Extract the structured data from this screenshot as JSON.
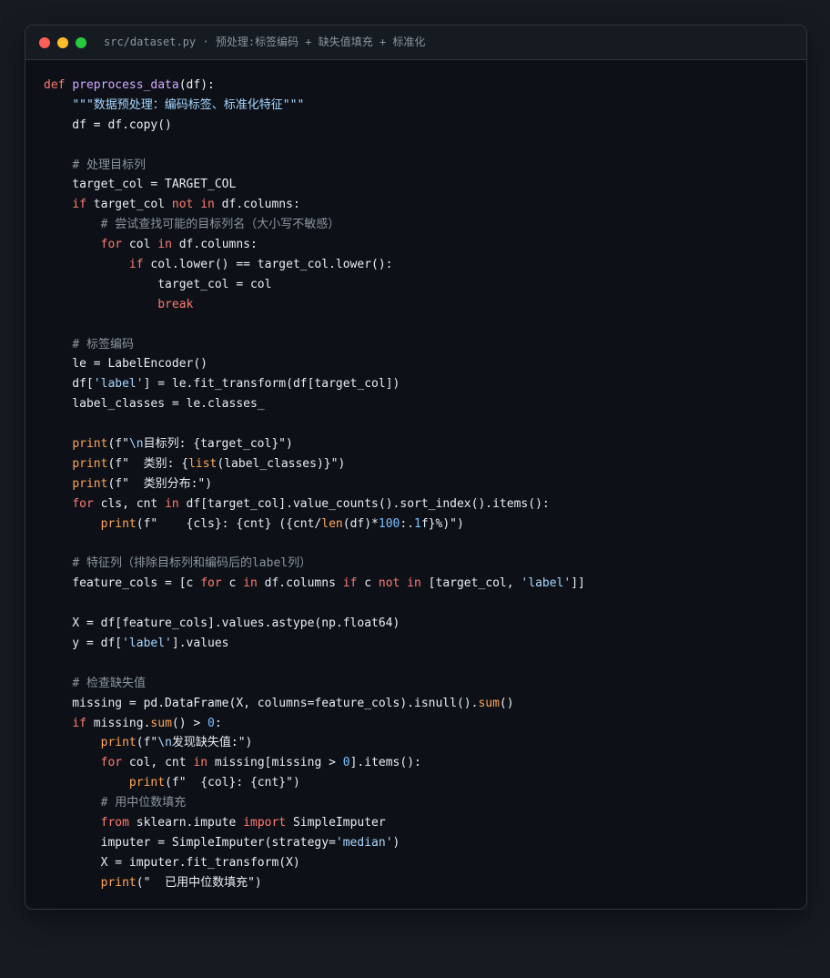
{
  "window": {
    "title": "src/dataset.py · 预处理:标签编码 + 缺失值填充 + 标准化"
  },
  "colors": {
    "keyword": "#ff7b72",
    "function": "#d2a8ff",
    "string": "#a5d6ff",
    "comment": "#8b949e",
    "builtin": "#ffa657",
    "number": "#79c0ff",
    "text": "#e6edf3",
    "background": "#0d1117"
  },
  "code": {
    "lines": [
      [
        [
          "kw",
          "def"
        ],
        [
          "txt",
          " "
        ],
        [
          "fn",
          "preprocess_data"
        ],
        [
          "txt",
          "(df):"
        ]
      ],
      [
        [
          "txt",
          "    "
        ],
        [
          "str",
          "\"\"\"数据预处理：编码标签、标准化特征\"\"\""
        ]
      ],
      [
        [
          "txt",
          "    df = df.copy()"
        ]
      ],
      [],
      [
        [
          "txt",
          "    "
        ],
        [
          "com",
          "# 处理目标列"
        ]
      ],
      [
        [
          "txt",
          "    target_col = TARGET_COL"
        ]
      ],
      [
        [
          "txt",
          "    "
        ],
        [
          "kw",
          "if"
        ],
        [
          "txt",
          " target_col "
        ],
        [
          "kw",
          "not in"
        ],
        [
          "txt",
          " df.columns:"
        ]
      ],
      [
        [
          "txt",
          "        "
        ],
        [
          "com",
          "# 尝试查找可能的目标列名（大小写不敏感）"
        ]
      ],
      [
        [
          "txt",
          "        "
        ],
        [
          "kw",
          "for"
        ],
        [
          "txt",
          " col "
        ],
        [
          "kw",
          "in"
        ],
        [
          "txt",
          " df.columns:"
        ]
      ],
      [
        [
          "txt",
          "            "
        ],
        [
          "kw",
          "if"
        ],
        [
          "txt",
          " col.lower() == target_col.lower():"
        ]
      ],
      [
        [
          "txt",
          "                target_col = col"
        ]
      ],
      [
        [
          "txt",
          "                "
        ],
        [
          "kw",
          "break"
        ]
      ],
      [],
      [
        [
          "txt",
          "    "
        ],
        [
          "com",
          "# 标签编码"
        ]
      ],
      [
        [
          "txt",
          "    le = LabelEncoder()"
        ]
      ],
      [
        [
          "txt",
          "    df["
        ],
        [
          "str",
          "'label'"
        ],
        [
          "txt",
          "] = le.fit_transform(df[target_col])"
        ]
      ],
      [
        [
          "txt",
          "    label_classes = le.classes_"
        ]
      ],
      [],
      [
        [
          "txt",
          "    "
        ],
        [
          "bi",
          "print"
        ],
        [
          "txt",
          "(f\""
        ],
        [
          "str",
          "\\n"
        ],
        [
          "txt",
          "目标列: {target_col}\")"
        ]
      ],
      [
        [
          "txt",
          "    "
        ],
        [
          "bi",
          "print"
        ],
        [
          "txt",
          "(f\"  类别: {"
        ],
        [
          "bi",
          "list"
        ],
        [
          "txt",
          "(label_classes)}\")"
        ]
      ],
      [
        [
          "txt",
          "    "
        ],
        [
          "bi",
          "print"
        ],
        [
          "txt",
          "(f\"  类别分布:\")"
        ]
      ],
      [
        [
          "txt",
          "    "
        ],
        [
          "kw",
          "for"
        ],
        [
          "txt",
          " cls, cnt "
        ],
        [
          "kw",
          "in"
        ],
        [
          "txt",
          " df[target_col].value_counts().sort_index().items():"
        ]
      ],
      [
        [
          "txt",
          "        "
        ],
        [
          "bi",
          "print"
        ],
        [
          "txt",
          "(f\"    {cls}: {cnt} ({cnt/"
        ],
        [
          "bi",
          "len"
        ],
        [
          "txt",
          "(df)*"
        ],
        [
          "num",
          "100"
        ],
        [
          "txt",
          ":."
        ],
        [
          "num",
          "1"
        ],
        [
          "txt",
          "f}%)\")"
        ]
      ],
      [],
      [
        [
          "txt",
          "    "
        ],
        [
          "com",
          "# 特征列（排除目标列和编码后的label列）"
        ]
      ],
      [
        [
          "txt",
          "    feature_cols = [c "
        ],
        [
          "kw",
          "for"
        ],
        [
          "txt",
          " c "
        ],
        [
          "kw",
          "in"
        ],
        [
          "txt",
          " df.columns "
        ],
        [
          "kw",
          "if"
        ],
        [
          "txt",
          " c "
        ],
        [
          "kw",
          "not in"
        ],
        [
          "txt",
          " [target_col, "
        ],
        [
          "str",
          "'label'"
        ],
        [
          "txt",
          "]]"
        ]
      ],
      [],
      [
        [
          "txt",
          "    X = df[feature_cols].values.astype(np.float64)"
        ]
      ],
      [
        [
          "txt",
          "    y = df["
        ],
        [
          "str",
          "'label'"
        ],
        [
          "txt",
          "].values"
        ]
      ],
      [],
      [
        [
          "txt",
          "    "
        ],
        [
          "com",
          "# 检查缺失值"
        ]
      ],
      [
        [
          "txt",
          "    missing = pd.DataFrame(X, columns=feature_cols).isnull()."
        ],
        [
          "bi",
          "sum"
        ],
        [
          "txt",
          "()"
        ]
      ],
      [
        [
          "txt",
          "    "
        ],
        [
          "kw",
          "if"
        ],
        [
          "txt",
          " missing."
        ],
        [
          "bi",
          "sum"
        ],
        [
          "txt",
          "() > "
        ],
        [
          "num",
          "0"
        ],
        [
          "txt",
          ":"
        ]
      ],
      [
        [
          "txt",
          "        "
        ],
        [
          "bi",
          "print"
        ],
        [
          "txt",
          "(f\""
        ],
        [
          "str",
          "\\n"
        ],
        [
          "txt",
          "发现缺失值:\")"
        ]
      ],
      [
        [
          "txt",
          "        "
        ],
        [
          "kw",
          "for"
        ],
        [
          "txt",
          " col, cnt "
        ],
        [
          "kw",
          "in"
        ],
        [
          "txt",
          " missing[missing > "
        ],
        [
          "num",
          "0"
        ],
        [
          "txt",
          "].items():"
        ]
      ],
      [
        [
          "txt",
          "            "
        ],
        [
          "bi",
          "print"
        ],
        [
          "txt",
          "(f\"  {col}: {cnt}\")"
        ]
      ],
      [
        [
          "txt",
          "        "
        ],
        [
          "com",
          "# 用中位数填充"
        ]
      ],
      [
        [
          "txt",
          "        "
        ],
        [
          "kw",
          "from"
        ],
        [
          "txt",
          " sklearn.impute "
        ],
        [
          "kw",
          "import"
        ],
        [
          "txt",
          " SimpleImputer"
        ]
      ],
      [
        [
          "txt",
          "        imputer = SimpleImputer(strategy="
        ],
        [
          "str",
          "'median'"
        ],
        [
          "txt",
          ")"
        ]
      ],
      [
        [
          "txt",
          "        X = imputer.fit_transform(X)"
        ]
      ],
      [
        [
          "txt",
          "        "
        ],
        [
          "bi",
          "print"
        ],
        [
          "txt",
          "(\"  已用中位数填充\")"
        ]
      ]
    ]
  }
}
